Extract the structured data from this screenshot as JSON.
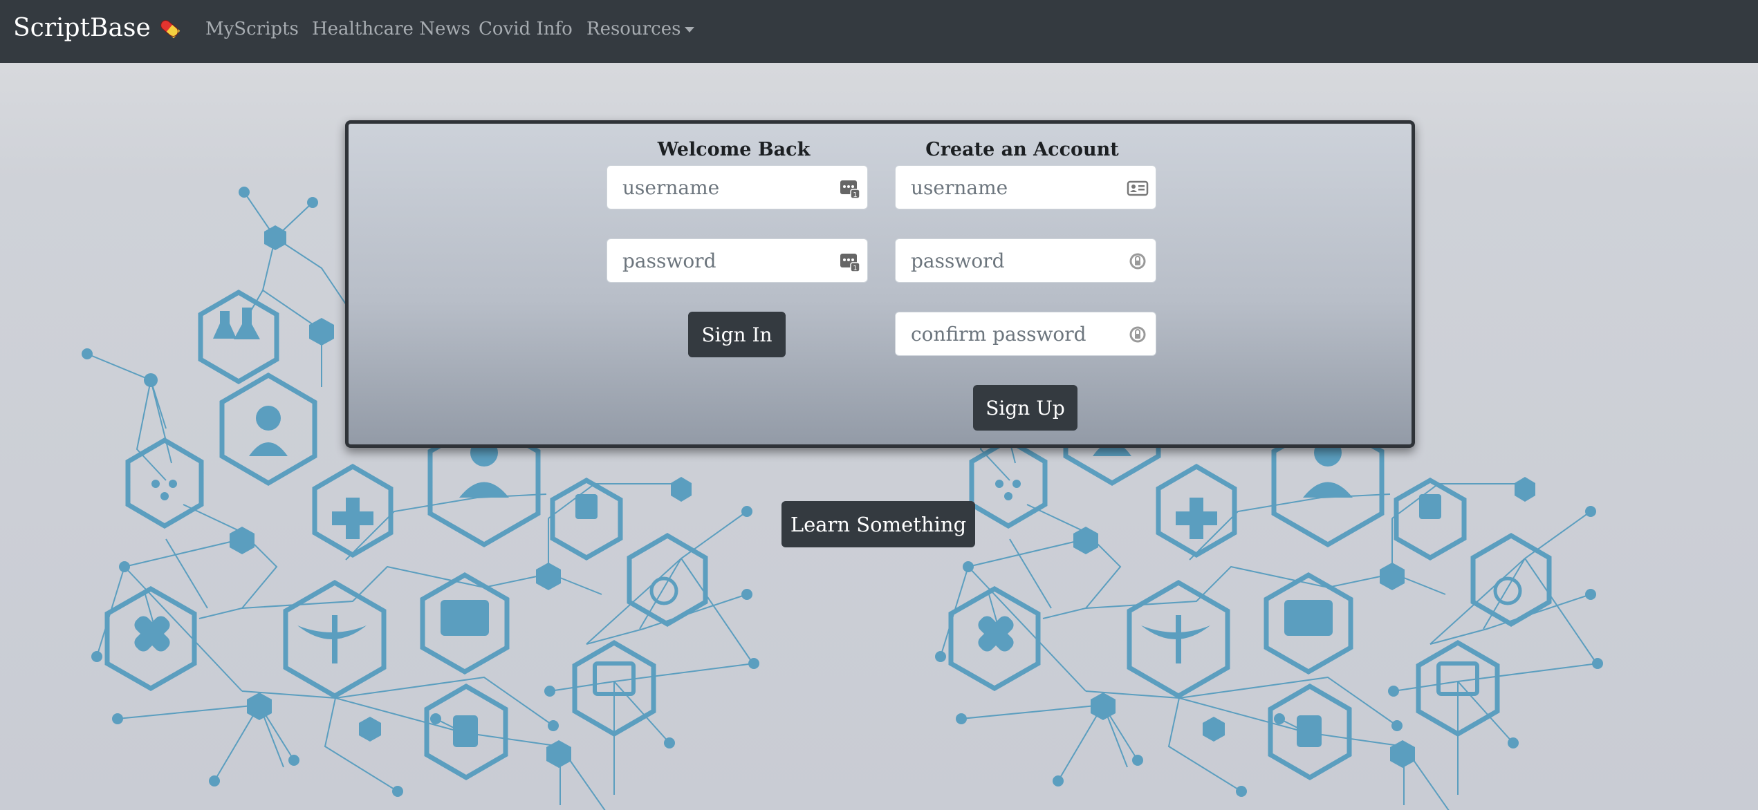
{
  "navbar": {
    "brand": "ScriptBase",
    "brand_icon": "pill-icon",
    "links": [
      "MyScripts",
      "Healthcare News",
      "Covid Info"
    ],
    "dropdown_label": "Resources"
  },
  "signin": {
    "title": "Welcome Back",
    "username_placeholder": "username",
    "password_placeholder": "password",
    "button": "Sign In"
  },
  "signup": {
    "title": "Create an Account",
    "username_placeholder": "username",
    "password_placeholder": "password",
    "confirm_placeholder": "confirm password",
    "button": "Sign Up"
  },
  "learn_button": "Learn Something",
  "colors": {
    "navbar": "#343a40",
    "network": "#5b9ebf",
    "button": "#343a40"
  }
}
